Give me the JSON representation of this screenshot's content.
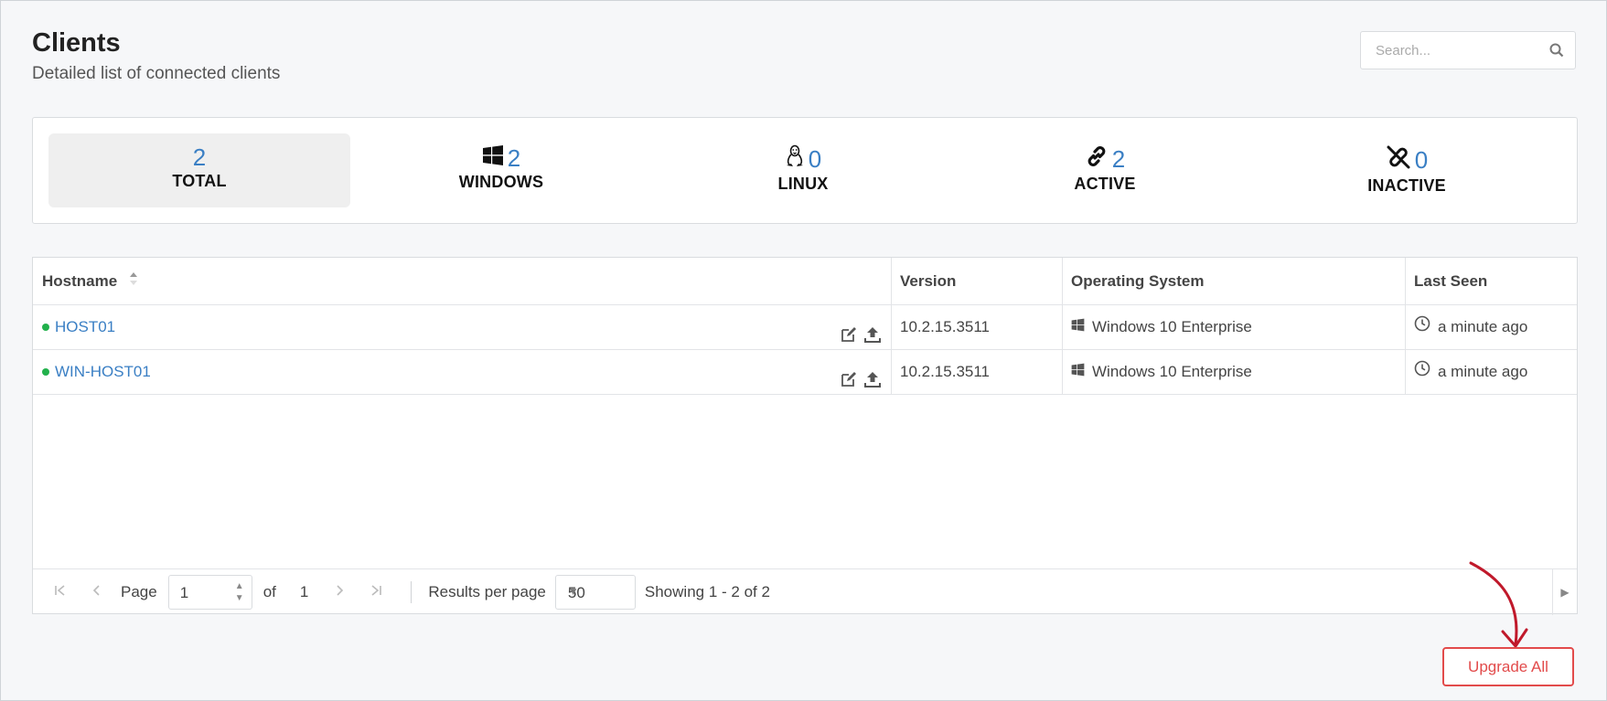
{
  "header": {
    "title": "Clients",
    "subtitle": "Detailed list of connected clients"
  },
  "search": {
    "placeholder": "Search..."
  },
  "stats": [
    {
      "value": "2",
      "label": "TOTAL",
      "icon": "",
      "selected": true
    },
    {
      "value": "2",
      "label": "WINDOWS",
      "icon": "windows-icon"
    },
    {
      "value": "0",
      "label": "LINUX",
      "icon": "linux-icon"
    },
    {
      "value": "2",
      "label": "ACTIVE",
      "icon": "link-icon"
    },
    {
      "value": "0",
      "label": "INACTIVE",
      "icon": "unlink-icon"
    }
  ],
  "table": {
    "columns": [
      "Hostname",
      "Version",
      "Operating System",
      "Last Seen"
    ],
    "rows": [
      {
        "hostname": "HOST01",
        "version": "10.2.15.3511",
        "os": "Windows 10 Enterprise",
        "last_seen": "a minute ago"
      },
      {
        "hostname": "WIN-HOST01",
        "version": "10.2.15.3511",
        "os": "Windows 10 Enterprise",
        "last_seen": "a minute ago"
      }
    ]
  },
  "pager": {
    "page_label": "Page",
    "page_value": "1",
    "of_label": "of",
    "total_pages": "1",
    "results_label": "Results per page",
    "per_page": "50",
    "showing": "Showing 1 - 2 of 2"
  },
  "actions": {
    "upgrade_all": "Upgrade All"
  },
  "colors": {
    "accent": "#3a7fc4",
    "active_dot": "#22b14c",
    "danger": "#e24b4b"
  }
}
